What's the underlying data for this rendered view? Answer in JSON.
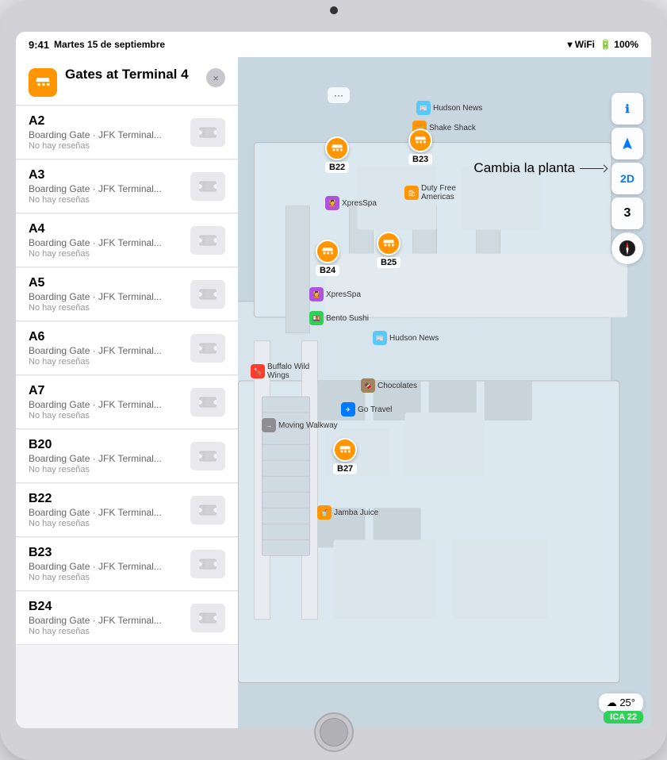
{
  "device": {
    "camera_dot": true,
    "home_button": true
  },
  "status_bar": {
    "time": "9:41",
    "date": "Martes 15 de septiembre",
    "wifi": "▾",
    "battery_percent": "100%"
  },
  "panel": {
    "title": "Gates at Terminal 4",
    "icon_label": "gate-icon",
    "close_label": "×",
    "gates": [
      {
        "name": "A2",
        "subtitle": "Boarding Gate · JFK Terminal...",
        "reviews": "No hay reseñas"
      },
      {
        "name": "A3",
        "subtitle": "Boarding Gate · JFK Terminal...",
        "reviews": "No hay reseñas"
      },
      {
        "name": "A4",
        "subtitle": "Boarding Gate · JFK Terminal...",
        "reviews": "No hay reseñas"
      },
      {
        "name": "A5",
        "subtitle": "Boarding Gate · JFK Terminal...",
        "reviews": "No hay reseñas"
      },
      {
        "name": "A6",
        "subtitle": "Boarding Gate · JFK Terminal...",
        "reviews": "No hay reseñas"
      },
      {
        "name": "A7",
        "subtitle": "Boarding Gate · JFK Terminal...",
        "reviews": "No hay reseñas"
      },
      {
        "name": "B20",
        "subtitle": "Boarding Gate · JFK Terminal...",
        "reviews": "No hay reseñas"
      },
      {
        "name": "B22",
        "subtitle": "Boarding Gate · JFK Terminal...",
        "reviews": "No hay reseñas"
      },
      {
        "name": "B23",
        "subtitle": "Boarding Gate · JFK Terminal...",
        "reviews": "No hay reseñas"
      },
      {
        "name": "B24",
        "subtitle": "Boarding Gate · JFK Terminal...",
        "reviews": "No hay reseñas"
      }
    ]
  },
  "map_controls": {
    "info_btn": "ℹ",
    "location_btn": "↑",
    "view_btn": "2D",
    "floor_btn": "3",
    "floor_callout": "Cambia la planta"
  },
  "map_pins": [
    {
      "id": "B22",
      "label": "B22"
    },
    {
      "id": "B23",
      "label": "B23"
    },
    {
      "id": "B24",
      "label": "B24"
    },
    {
      "id": "B25",
      "label": "B25"
    },
    {
      "id": "B27",
      "label": "B27"
    }
  ],
  "map_places": [
    {
      "name": "Hudson News",
      "color": "#5ac8fa"
    },
    {
      "name": "Shake Shack",
      "color": "#ff9500"
    },
    {
      "name": "XpresSpa",
      "color": "#af52de"
    },
    {
      "name": "XpresSpa",
      "color": "#af52de"
    },
    {
      "name": "Duty Free Americas",
      "color": "#ff9500"
    },
    {
      "name": "Bento Sushi",
      "color": "#30d158"
    },
    {
      "name": "Hudson News",
      "color": "#5ac8fa"
    },
    {
      "name": "Buffalo Wild Wings",
      "color": "#ff3b30"
    },
    {
      "name": "Chocolates",
      "color": "#a2845e"
    },
    {
      "name": "Go Travel",
      "color": "#007aff"
    },
    {
      "name": "Moving Walkway",
      "color": "#8e8e93"
    },
    {
      "name": "Jamba Juice",
      "color": "#ff9500"
    }
  ],
  "weather": {
    "temp": "25°",
    "icon": "☁"
  },
  "ica_badge": "ICA 22",
  "more_btn": "···"
}
